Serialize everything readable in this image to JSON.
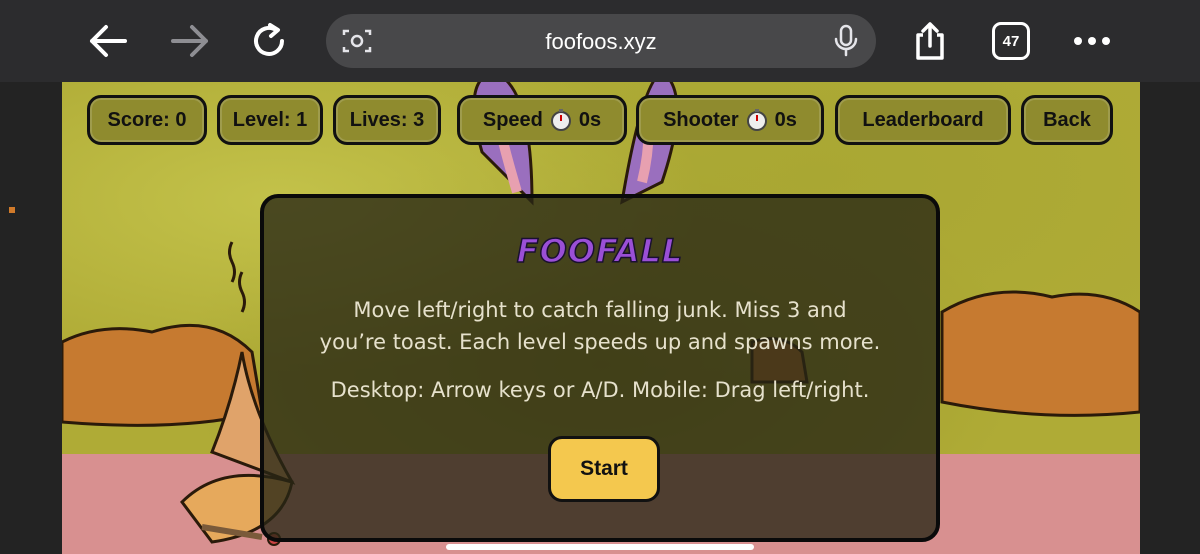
{
  "browser": {
    "url": "foofoos.xyz",
    "tab_count": "47"
  },
  "hud": {
    "score": "Score: 0",
    "level": "Level: 1",
    "lives": "Lives: 3",
    "speed_label": "Speed",
    "speed_time": "0s",
    "shooter_label": "Shooter",
    "shooter_time": "0s",
    "leaderboard": "Leaderboard",
    "back": "Back"
  },
  "modal": {
    "title": "FOOFALL",
    "description_line1": "Move left/right to catch falling junk. Miss 3 and",
    "description_line2": "you’re toast. Each level speeds up and spawns more.",
    "controls": "Desktop: Arrow keys or A/D. Mobile: Drag left/right.",
    "start_label": "Start"
  },
  "colors": {
    "accent_start": "#f4c84e",
    "title_purple": "#9a4fd6",
    "hud_pill": "#8f8b2e"
  }
}
